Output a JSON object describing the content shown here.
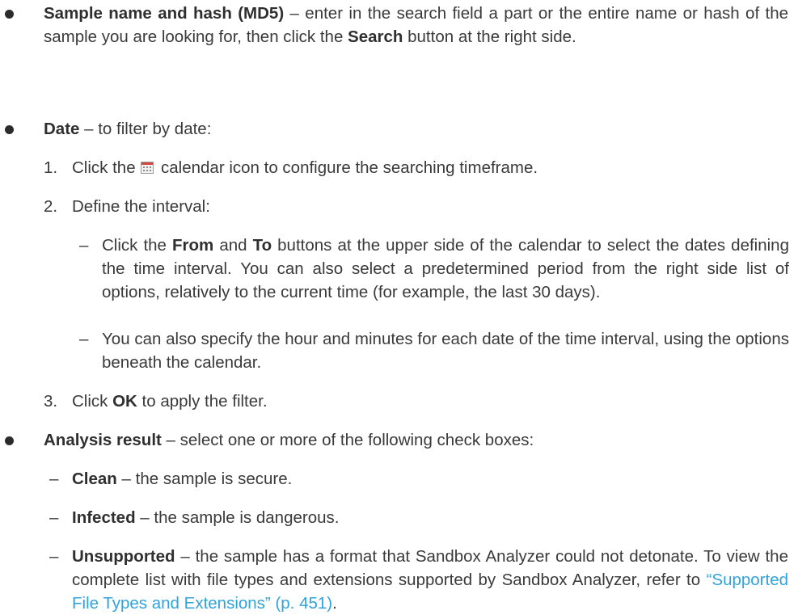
{
  "bullet1": {
    "term": "Sample name and hash (MD5)",
    "text": " – enter in the search field a part or the entire name or hash of the sample you are looking for, then click the ",
    "search_label": "Search",
    "text_end": " button at the right side."
  },
  "bullet2": {
    "term": "Date",
    "text": " – to filter by date:",
    "steps": [
      {
        "num": "1.",
        "before": "Click the ",
        "icon": "calendar-icon",
        "after": " calendar icon to configure the searching timeframe."
      },
      {
        "num": "2.",
        "text": "Define the interval:"
      },
      {
        "num": "3.",
        "before": "Click ",
        "bold": "OK",
        "after": " to apply the filter."
      }
    ],
    "sub": [
      {
        "dash": "–",
        "before": "Click the ",
        "from": "From",
        "mid": " and ",
        "to": "To",
        "after": " buttons at the upper side of the calendar to select the dates defining the time interval. You can also select a predetermined period from the right side list of options, relatively to the current time (for example, the last 30 days)."
      },
      {
        "dash": "–",
        "text": "You can also specify the hour and minutes for each date of the time interval, using the options beneath the calendar."
      }
    ]
  },
  "bullet3": {
    "term": "Analysis result",
    "text": " – select one or more of the following check boxes:",
    "items": [
      {
        "dash": "–",
        "term": "Clean",
        "text": " – the sample is secure."
      },
      {
        "dash": "–",
        "term": "Infected",
        "text": " – the sample is dangerous."
      },
      {
        "dash": "–",
        "term": "Unsupported",
        "text": " – the sample has a format that Sandbox Analyzer could not detonate. To view the complete list with file types and extensions supported by Sandbox Analyzer, refer to ",
        "link": "“Supported File Types and Extensions” (p. 451)",
        "end": "."
      }
    ]
  }
}
